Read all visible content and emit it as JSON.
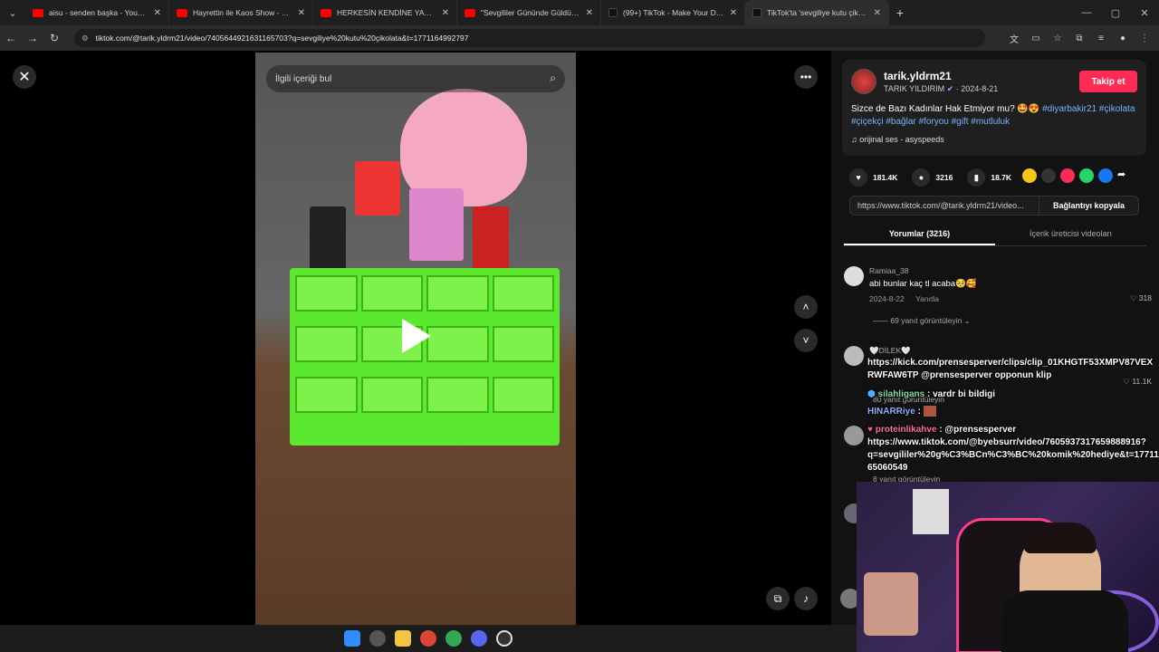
{
  "browser": {
    "tabs": [
      {
        "title": "aisu - senden başka - YouTube",
        "icon": "youtube-icon",
        "active": false
      },
      {
        "title": "Hayrettin ile Kaos Show - 2.Sez",
        "icon": "youtube-icon",
        "active": false
      },
      {
        "title": "HERKESİN KENDİNE YAKIŞANI",
        "icon": "youtube-icon",
        "active": false
      },
      {
        "title": "\"Sevgililer Gününde Güldüren",
        "icon": "youtube-icon",
        "active": false
      },
      {
        "title": "(99+) TikTok - Make Your Day",
        "icon": "tiktok-icon",
        "active": false
      },
      {
        "title": "TikTok'ta 'sevgiliye kutu çikolat",
        "icon": "tiktok-icon",
        "active": true
      }
    ],
    "url": "tiktok.com/@tarik.yldrm21/video/7405644921631165703?q=sevgiliye%20kutu%20çikolata&t=1771164992797"
  },
  "video": {
    "search_placeholder": "İlgili içeriği bul"
  },
  "post": {
    "username": "tarik.yldrm21",
    "display_name": "TARIK YILDIRIM",
    "date": "2024-8-21",
    "follow_label": "Takip et",
    "caption_text": "Sizce de Bazı Kadınlar Hak Etmiyor mu? 🤩😍 ",
    "caption_tags": "#diyarbakir21 #çikolata #çiçekçi #bağlar #foryou #gift #mutluluk",
    "music": "orijinal ses - asyspeeds",
    "likes": "181.4K",
    "comments_count": "3216",
    "saves": "18.7K",
    "link": "https://www.tiktok.com/@tarik.yldrm21/video...",
    "copy_label": "Bağlantıyı kopyala",
    "tab_comments": "Yorumlar (3216)",
    "tab_creator": "İçerik üreticisi videoları"
  },
  "comments": [
    {
      "name": "Ramiaa_38",
      "text": "abi bunlar kaç tl acaba🥺🥰",
      "date": "2024-8-22",
      "reply_label": "Yanıtla",
      "likes": "318",
      "view_replies": "69 yanıt görüntüleyin"
    },
    {
      "name": "🤍DİLEK🤍",
      "text": "",
      "date": "",
      "reply_label": "",
      "likes": "11.1K",
      "view_replies": "80 yanıt görüntüleyin"
    },
    {
      "name": "",
      "text": "",
      "date": "",
      "reply_label": "",
      "likes": "",
      "view_replies": "8 yanıt görüntüleyin"
    }
  ],
  "stream_chat": [
    {
      "line1": "https://kick.com/prensesperver/clips/clip_01KHGTF53XMPV87VEX",
      "line2": "RWFAW6TP @prensesperver opponun klip"
    },
    {
      "user": "silahligans",
      "msg": ": vardr bi bildigi"
    },
    {
      "user": "HINARRiye",
      "msg": ":"
    },
    {
      "user": "proteinlikahve",
      "msg": ": @prensesperver",
      "line2": "https://www.tiktok.com/@byebsurr/video/7605937317659888916?",
      "line3": "q=sevgililer%20g%C3%BCn%C3%BC%20komik%20hediye&t=17711",
      "line4": "65060549"
    }
  ],
  "colors": {
    "accent": "#fe2c55",
    "tag": "#76b3ff",
    "panel": "#121212"
  }
}
